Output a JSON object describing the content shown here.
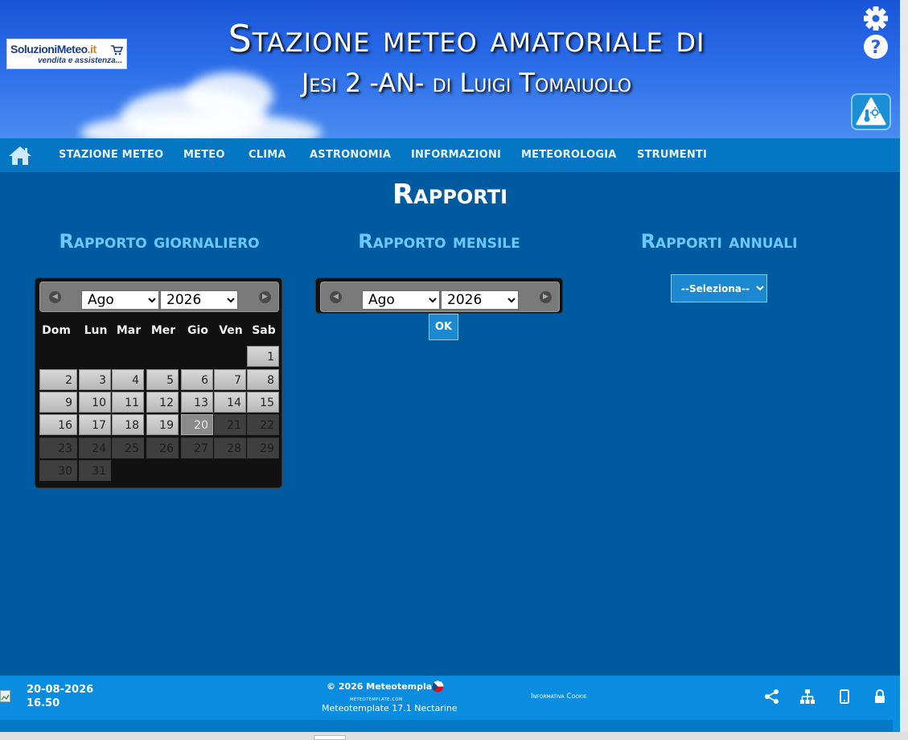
{
  "header": {
    "logo": {
      "brand": "SoluzioniMeteo",
      "tld": ".it",
      "tagline": "vendita e assistenza..."
    },
    "title": "Stazione meteo amatoriale di",
    "subtitle": "Jesi 2 -AN- di Luigi Tomaiuolo"
  },
  "nav": {
    "items": [
      {
        "label": "STAZIONE METEO"
      },
      {
        "label": "METEO"
      },
      {
        "label": "CLIMA"
      },
      {
        "label": "ASTRONOMIA"
      },
      {
        "label": "INFORMAZIONI"
      },
      {
        "label": "METEOROLOGIA"
      },
      {
        "label": "STRUMENTI"
      }
    ]
  },
  "main": {
    "title": "Rapporti",
    "daily": {
      "title": "Rapporto giornaliero",
      "month": "Ago",
      "year": "2026",
      "weekdays": [
        "Dom",
        "Lun",
        "Mar",
        "Mer",
        "Gio",
        "Ven",
        "Sab"
      ],
      "days": [
        "1",
        "2",
        "3",
        "4",
        "5",
        "6",
        "7",
        "8",
        "9",
        "10",
        "11",
        "12",
        "13",
        "14",
        "15",
        "16",
        "17",
        "18",
        "19",
        "20",
        "21",
        "22",
        "23",
        "24",
        "25",
        "26",
        "27",
        "28",
        "29",
        "30",
        "31"
      ],
      "today": "20"
    },
    "monthly": {
      "title": "Rapporto mensile",
      "month": "Ago",
      "year": "2026",
      "ok_label": "OK"
    },
    "annual": {
      "title": "Rapporti annuali",
      "select_label": "--Seleziona--"
    }
  },
  "footer": {
    "date": "20-08-2026",
    "time": "16.50",
    "copyright": "© 2026  Meteotemplate",
    "site": "meteotemplate.com",
    "version": "Meteotemplate 17.1 Nectarine",
    "cookie": "Informativa Cookie"
  },
  "colors": {
    "page_bg": "#005aa0",
    "navbar": "#0576c4",
    "accent_title": "#6ec8ff",
    "footer": "#0a8de0"
  }
}
